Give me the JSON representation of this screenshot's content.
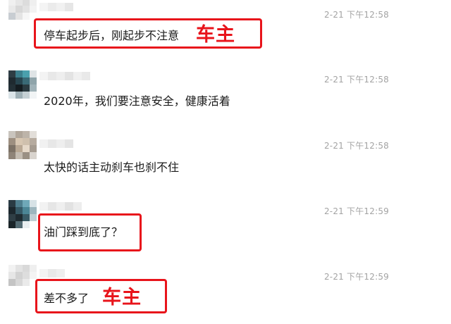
{
  "messages": [
    {
      "timestamp": "2-21 下午12:58",
      "text": "停车起步后，刚起步不注意",
      "annotation": "车主",
      "highlighted": true
    },
    {
      "timestamp": "2-21 下午12:58",
      "text": "2020年，我们要注意安全，健康活着",
      "annotation": "",
      "highlighted": false
    },
    {
      "timestamp": "2-21 下午12:58",
      "text": "太快的话主动刹车也刹不住",
      "annotation": "",
      "highlighted": false
    },
    {
      "timestamp": "2-21 下午12:59",
      "text": "油门踩到底了？",
      "annotation": "",
      "highlighted": true
    },
    {
      "timestamp": "2-21 下午12:59",
      "text": "差不多了",
      "annotation": "车主",
      "highlighted": true
    }
  ],
  "colors": {
    "highlight": "#e8141b",
    "timestamp": "#a3a3a3",
    "text": "#1a1a1a"
  },
  "icons": [
    "avatar-blurred",
    "username-blurred"
  ]
}
